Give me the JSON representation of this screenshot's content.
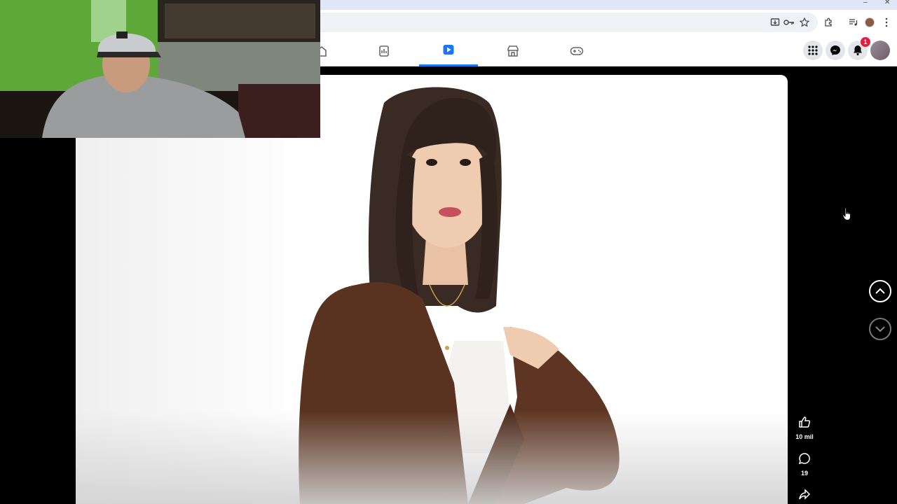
{
  "browser": {
    "window_controls": [
      "–",
      "✕"
    ],
    "toolbar_icons": [
      "install-icon",
      "key-icon",
      "star-icon",
      "extensions-icon",
      "media-icon",
      "profile-icon",
      "menu-icon"
    ]
  },
  "facebook_nav": {
    "tabs": [
      "home-tab",
      "news-tab",
      "video-tab",
      "marketplace-tab",
      "gaming-tab"
    ],
    "active_tab": "video-tab",
    "accent_color": "#1877f2",
    "notification_count": "1"
  },
  "reel": {
    "likes": "10 mil",
    "comments": "19"
  }
}
